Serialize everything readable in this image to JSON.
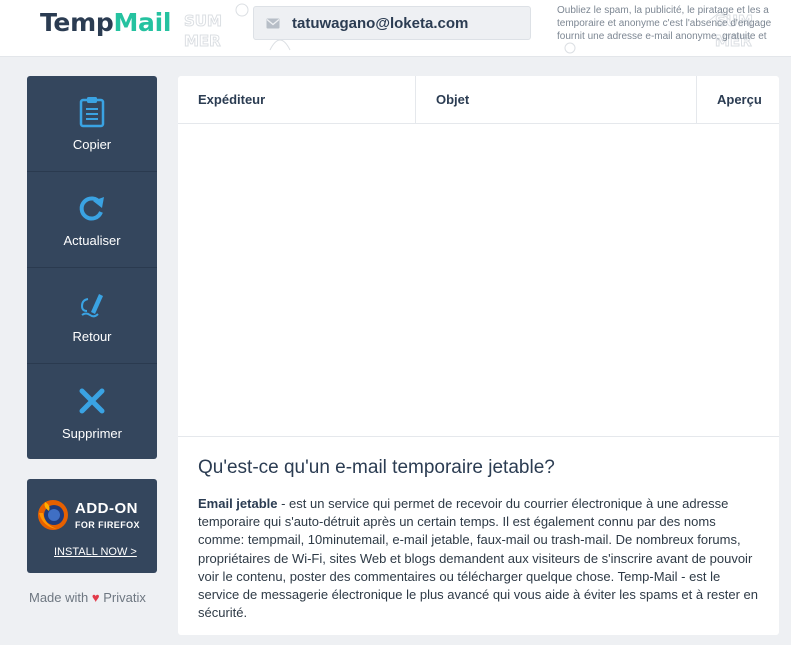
{
  "header": {
    "logo_part1": "Temp",
    "logo_part2": "Mail",
    "email_address": "tatuwagano@loketa.com",
    "description_lines": [
      "Oubliez le spam, la publicité, le piratage et les a",
      "temporaire et anonyme c'est l'absence d'engage",
      "fournit une adresse e-mail anonyme, gratuite et"
    ]
  },
  "sidebar": {
    "buttons": [
      {
        "label": "Copier",
        "icon": "clipboard-icon"
      },
      {
        "label": "Actualiser",
        "icon": "refresh-icon"
      },
      {
        "label": "Retour",
        "icon": "edit-pen-icon"
      },
      {
        "label": "Supprimer",
        "icon": "close-icon"
      }
    ]
  },
  "addon": {
    "title": "ADD-ON",
    "subtitle": "FOR FIREFOX",
    "link": "INSTALL NOW >",
    "icon": "firefox-icon"
  },
  "footer": {
    "made_with": "Made with",
    "brand": "Privatix",
    "heart": "♥"
  },
  "inbox": {
    "columns": [
      "Expéditeur",
      "Objet",
      "Aperçu"
    ]
  },
  "info": {
    "title": "Qu'est-ce qu'un e-mail temporaire jetable?",
    "lead": "Email jetable",
    "body": " - est un service qui permet de recevoir du courrier électronique à une adresse temporaire qui s'auto-détruit après un certain temps. Il est également connu par des noms comme: tempmail, 10minutemail, e-mail jetable, faux-mail ou trash-mail. De nombreux forums, propriétaires de Wi-Fi, sites Web et blogs demandent aux visiteurs de s'inscrire avant de pouvoir voir le contenu, poster des commentaires ou télécharger quelque chose. Temp-Mail - est le service de messagerie électronique le plus avancé qui vous aide à éviter les spams et à rester en sécurité."
  },
  "colors": {
    "sidebar_bg": "#34465d",
    "accent_teal": "#25c2a0",
    "icon_blue": "#3aa3e3",
    "heart_red": "#e23b4a"
  }
}
